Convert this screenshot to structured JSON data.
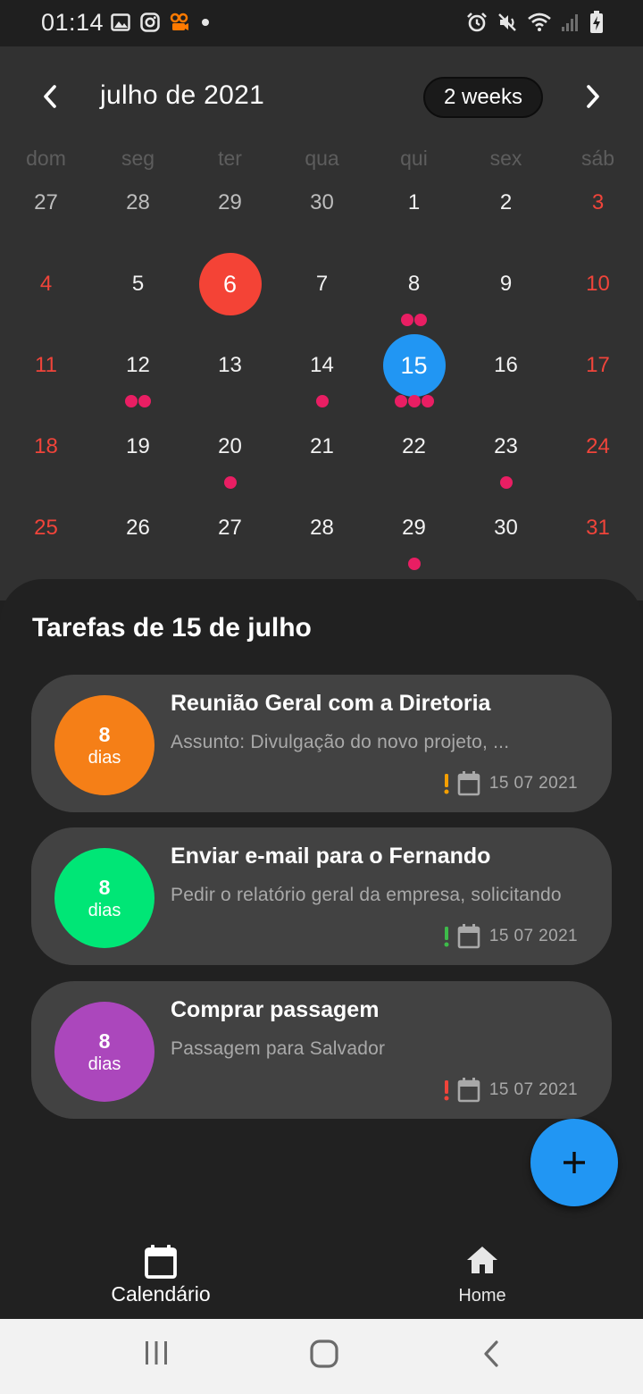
{
  "status_bar": {
    "time": "01:14",
    "left_icons": [
      "image-icon",
      "instagram-icon",
      "notification-app-icon",
      "dot-icon"
    ],
    "right_icons": [
      "alarm-icon",
      "vibrate-mute-icon",
      "wifi-icon",
      "signal-icon",
      "battery-charging-icon"
    ]
  },
  "calendar": {
    "month_title": "julho de 2021",
    "format_button": "2 weeks",
    "prev_icon": "chevron-left-icon",
    "next_icon": "chevron-right-icon",
    "weekdays": [
      "dom",
      "seg",
      "ter",
      "qua",
      "qui",
      "sex",
      "sáb"
    ],
    "days": [
      {
        "d": "27",
        "outside": true,
        "weekend": false,
        "events": 0
      },
      {
        "d": "28",
        "outside": true,
        "weekend": false,
        "events": 0
      },
      {
        "d": "29",
        "outside": true,
        "weekend": false,
        "events": 0
      },
      {
        "d": "30",
        "outside": true,
        "weekend": false,
        "events": 0
      },
      {
        "d": "1",
        "weekend": false,
        "events": 0
      },
      {
        "d": "2",
        "weekend": false,
        "events": 0
      },
      {
        "d": "3",
        "weekend": true,
        "events": 0
      },
      {
        "d": "4",
        "weekend": true,
        "events": 0
      },
      {
        "d": "5",
        "weekend": false,
        "events": 0
      },
      {
        "d": "6",
        "weekend": false,
        "events": 0,
        "today": true
      },
      {
        "d": "7",
        "weekend": false,
        "events": 0
      },
      {
        "d": "8",
        "weekend": false,
        "events": 2
      },
      {
        "d": "9",
        "weekend": false,
        "events": 0
      },
      {
        "d": "10",
        "weekend": true,
        "events": 0
      },
      {
        "d": "11",
        "weekend": true,
        "events": 0
      },
      {
        "d": "12",
        "weekend": false,
        "events": 2
      },
      {
        "d": "13",
        "weekend": false,
        "events": 0
      },
      {
        "d": "14",
        "weekend": false,
        "events": 1
      },
      {
        "d": "15",
        "weekend": false,
        "events": 3,
        "selected": true
      },
      {
        "d": "16",
        "weekend": false,
        "events": 0
      },
      {
        "d": "17",
        "weekend": true,
        "events": 0
      },
      {
        "d": "18",
        "weekend": true,
        "events": 0
      },
      {
        "d": "19",
        "weekend": false,
        "events": 0
      },
      {
        "d": "20",
        "weekend": false,
        "events": 1
      },
      {
        "d": "21",
        "weekend": false,
        "events": 0
      },
      {
        "d": "22",
        "weekend": false,
        "events": 0
      },
      {
        "d": "23",
        "weekend": false,
        "events": 1
      },
      {
        "d": "24",
        "weekend": true,
        "events": 0
      },
      {
        "d": "25",
        "weekend": true,
        "events": 0
      },
      {
        "d": "26",
        "weekend": false,
        "events": 0
      },
      {
        "d": "27",
        "weekend": false,
        "events": 0
      },
      {
        "d": "28",
        "weekend": false,
        "events": 0
      },
      {
        "d": "29",
        "weekend": false,
        "events": 1
      },
      {
        "d": "30",
        "weekend": false,
        "events": 0
      },
      {
        "d": "31",
        "weekend": true,
        "events": 0
      }
    ],
    "colors": {
      "today": "#f44336",
      "selected": "#2196f3",
      "marker": "#e91e63",
      "weekend": "#f0443a"
    }
  },
  "tasks_section": {
    "title": "Tarefas de 15 de julho"
  },
  "tasks": [
    {
      "title": "Reunião Geral com a Diretoria",
      "description": "Assunto: Divulgação do novo projeto, ...",
      "count": "8",
      "unit": "dias",
      "date": "15 07 2021",
      "circle_color": "#f57f17",
      "priority_color": "#f59f00"
    },
    {
      "title": "Enviar e-mail para o Fernando",
      "description": "Pedir o relatório geral da empresa, solicitando",
      "count": "8",
      "unit": "dias",
      "date": "15 07 2021",
      "circle_color": "#00e676",
      "priority_color": "#3dbb4a"
    },
    {
      "title": "Comprar passagem",
      "description": "Passagem para Salvador",
      "count": "8",
      "unit": "dias",
      "date": "15 07 2021",
      "circle_color": "#ab47bc",
      "priority_color": "#f0443a"
    }
  ],
  "fab": {
    "icon": "plus-icon",
    "color": "#2196f3"
  },
  "bottom_nav": {
    "calendar_label": "Calendário",
    "home_label": "Home"
  },
  "system_nav": {
    "recents_icon": "recents-icon",
    "home_icon": "home-circle-icon",
    "back_icon": "back-icon"
  }
}
